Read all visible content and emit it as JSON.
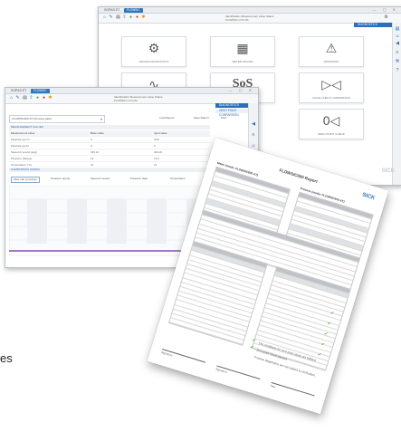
{
  "app": {
    "title": "SOPAS ET",
    "tab_device": "FLOWSIC",
    "device_info": {
      "labels": "Identification  Measurement value  Status",
      "values": "FLOWSIC   m³/h   OK"
    }
  },
  "brand": "SICK",
  "back_window": {
    "menu_label": "DIAGNOSTICS",
    "tiles": [
      {
        "icon": "meter-icon",
        "glyph": "⚙",
        "label": "DEVICE DIAGNOSTICS"
      },
      {
        "icon": "matrix-icon",
        "glyph": "▦",
        "label": "METER VALUES"
      },
      {
        "icon": "warning-icon",
        "glyph": "⚠",
        "label": "WARNINGS"
      },
      {
        "icon": "waveform-icon",
        "glyph": "∿",
        "label": "SIGNALS"
      },
      {
        "icon": "sos-icon",
        "glyph": "SoS",
        "label": ""
      },
      {
        "icon": "valve-icon",
        "glyph": "▷◁",
        "label": "VALVE CHECK COMPARISON"
      },
      {
        "icon": "zero-check-icon",
        "glyph": "0◁",
        "label": "ZERO POINT CHECK"
      }
    ]
  },
  "front_window": {
    "menu_label": "DIAGNOSTICS",
    "submenu_label": "ZERO POINT COMPARISON",
    "selector": "FLOWSIC600-XT (Process path)",
    "buttons": {
      "load": "Load Report",
      "save": "Save Report",
      "print": "Print"
    },
    "section_title": "MEASUREMENT VALUES",
    "table": {
      "headers": [
        "Measurement value",
        "Base value",
        "Input value"
      ],
      "rows": [
        [
          "Flowrate (qv,m)",
          "0",
          "0.00"
        ],
        [
          "Flowrate (qv,b)",
          "0",
          "0"
        ],
        [
          "Speed of sound (avg)",
          "343.21",
          "343.22"
        ],
        [
          "Pressure (bar(a))",
          "14",
          "14.0"
        ],
        [
          "Temperature (°C)",
          "21",
          "21"
        ]
      ]
    },
    "comparison_title": "COMPARISON GRAPH",
    "checks": [
      "Flow rate (process)",
      "Pressure (input)",
      "Speed of sound",
      "Pressure (bar)",
      "Temperature"
    ]
  },
  "report": {
    "title": "FLOWSIC600 Report",
    "section_left": "Meter (mode: FLOWSIC600-XT)",
    "section_right": "Process (mode: FLOWSIC600-XT)",
    "notes": [
      "The conditions for zero point check are fulfilled.",
      "Zero point check passed.",
      "Process diagnostics are not subject to verification."
    ],
    "signature_labels": [
      "Signature",
      "Signature",
      "Date"
    ]
  },
  "fragment": "es"
}
